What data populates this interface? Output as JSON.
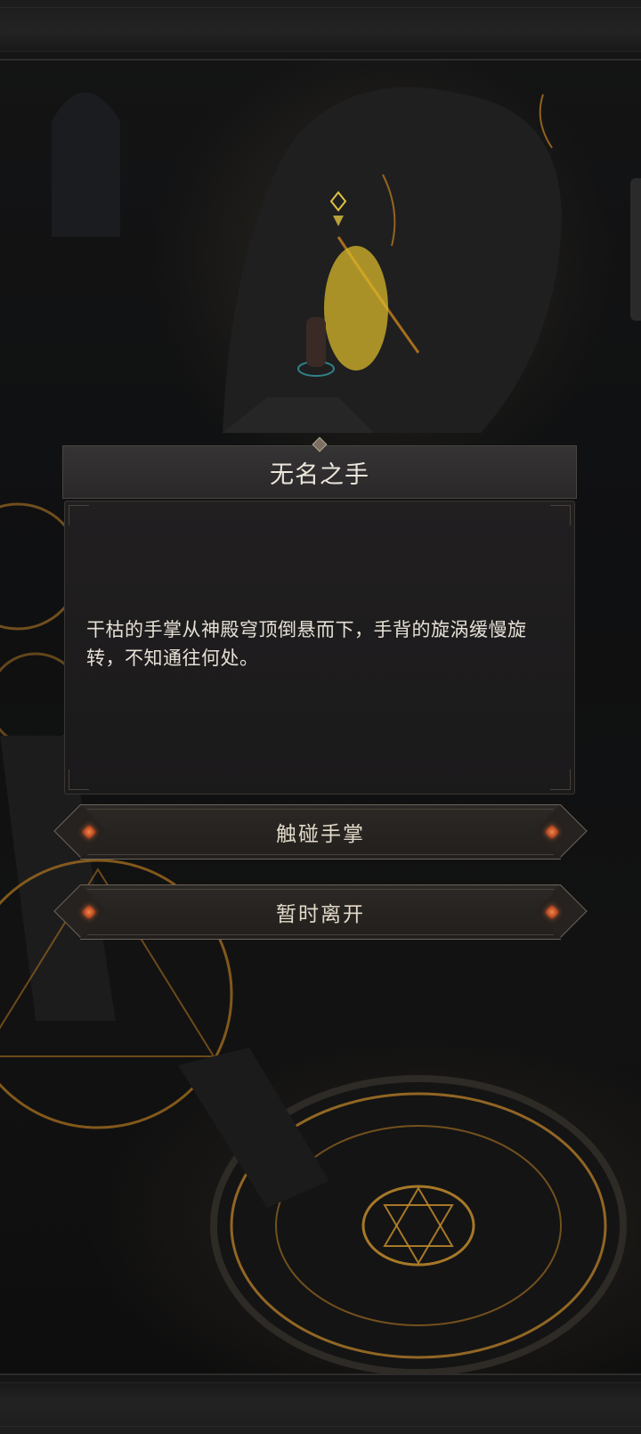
{
  "event": {
    "title": "无名之手",
    "description": "干枯的手掌从神殿穹顶倒悬而下，手背的旋涡缓慢旋转，不知通往何处。"
  },
  "choices": [
    {
      "label": "触碰手掌"
    },
    {
      "label": "暂时离开"
    }
  ],
  "colors": {
    "portal_glow": "#ebcd28",
    "rune_gold": "#b07a28",
    "gem_orange": "#f08a4a",
    "panel_bg": "#1e1c1d",
    "text_light": "#e6e0d6"
  }
}
